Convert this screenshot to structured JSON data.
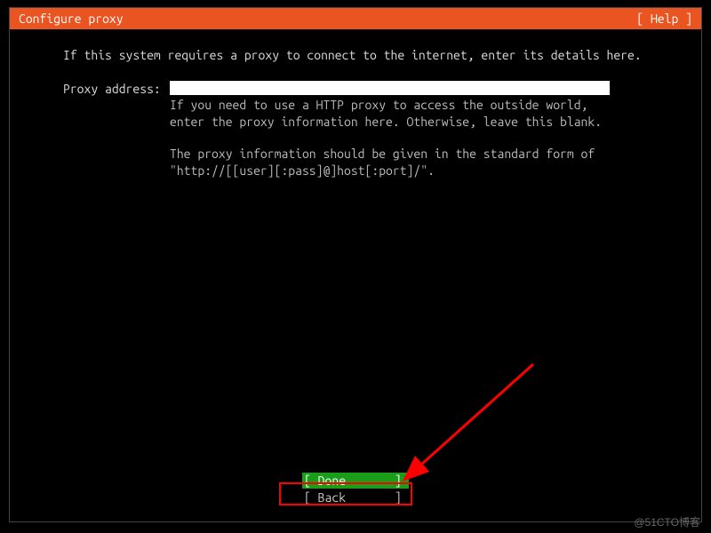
{
  "header": {
    "title": "Configure proxy",
    "help": "[ Help ]"
  },
  "intro": "If this system requires a proxy to connect to the internet, enter its details here.",
  "field": {
    "label": "Proxy address:",
    "value": "",
    "hint1": "If you need to use a HTTP proxy to access the outside world, enter the proxy information here. Otherwise, leave this blank.",
    "hint2": "The proxy information should be given in the standard form of \"http://[[user][:pass]@]host[:port]/\"."
  },
  "buttons": {
    "done": "[ Done       ]",
    "back": "[ Back       ]"
  },
  "watermark": "@51CTO博客"
}
